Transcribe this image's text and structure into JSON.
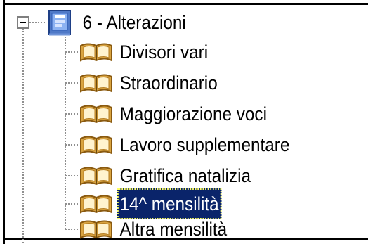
{
  "tree": {
    "root": {
      "label": "6 - Alterazioni",
      "icon": "folder-icon",
      "expander": "collapse-icon",
      "expanded": true
    },
    "children": [
      {
        "label": "Divisori vari",
        "icon": "book-icon"
      },
      {
        "label": "Straordinario",
        "icon": "book-icon"
      },
      {
        "label": "Maggiorazione voci",
        "icon": "book-icon"
      },
      {
        "label": "Lavoro supplementare",
        "icon": "book-icon"
      },
      {
        "label": "Gratifica natalizia",
        "icon": "book-icon"
      },
      {
        "label": "14^ mensilità",
        "icon": "book-icon",
        "selected": true
      },
      {
        "label": "Altra mensilità",
        "icon": "book-icon"
      }
    ]
  },
  "colors": {
    "selection_background": "#0a246a",
    "selection_text": "#ffffff",
    "folder_blue": "#4f79c7",
    "book_gold": "#d9a441"
  }
}
